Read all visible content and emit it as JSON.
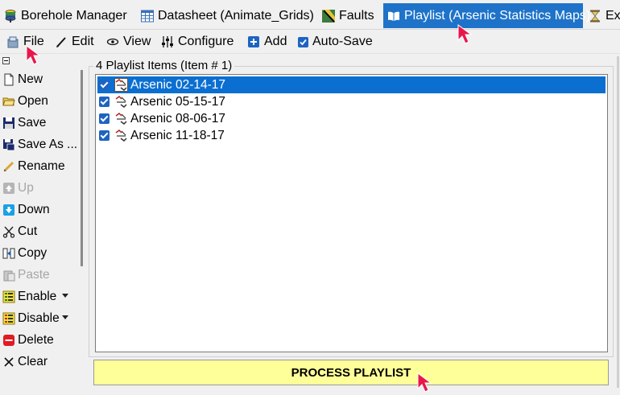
{
  "tabs": [
    {
      "label": "Borehole Manager",
      "icon": "borehole-icon"
    },
    {
      "label": "Datasheet (Animate_Grids)",
      "icon": "datasheet-icon"
    },
    {
      "label": "Faults",
      "icon": "faults-icon"
    },
    {
      "label": "Playlist (Arsenic Statistics Maps)",
      "icon": "book-icon",
      "active": true
    },
    {
      "label": "Exe",
      "icon": "hourglass-icon"
    }
  ],
  "toolbar": {
    "file": "File",
    "edit": "Edit",
    "view": "View",
    "configure": "Configure",
    "add": "Add",
    "autosave": "Auto-Save"
  },
  "sidebar": {
    "items": [
      {
        "label": "New",
        "icon": "new-file-icon",
        "enabled": true
      },
      {
        "label": "Open",
        "icon": "folder-icon",
        "enabled": true
      },
      {
        "label": "Save",
        "icon": "save-icon",
        "enabled": true
      },
      {
        "label": "Save As ...",
        "icon": "save-as-icon",
        "enabled": true
      },
      {
        "label": "Rename",
        "icon": "pencil-icon",
        "enabled": true
      },
      {
        "label": "Up",
        "icon": "arrow-up-icon",
        "enabled": false
      },
      {
        "label": "Down",
        "icon": "arrow-down-icon",
        "enabled": true
      },
      {
        "label": "Cut",
        "icon": "scissors-icon",
        "enabled": true
      },
      {
        "label": "Copy",
        "icon": "copy-icon",
        "enabled": true
      },
      {
        "label": "Paste",
        "icon": "paste-icon",
        "enabled": false
      },
      {
        "label": "Enable",
        "icon": "list-check-icon",
        "enabled": true
      },
      {
        "label": "Disable",
        "icon": "list-uncheck-icon",
        "enabled": true
      },
      {
        "label": "Delete",
        "icon": "delete-icon",
        "enabled": true
      },
      {
        "label": "Clear",
        "icon": "clear-x-icon",
        "enabled": true
      }
    ]
  },
  "playlist": {
    "header": "4 Playlist Items (Item # 1)",
    "items": [
      {
        "label": "Arsenic 02-14-17",
        "checked": true,
        "selected": true
      },
      {
        "label": "Arsenic 05-15-17",
        "checked": true,
        "selected": false
      },
      {
        "label": "Arsenic 08-06-17",
        "checked": true,
        "selected": false
      },
      {
        "label": "Arsenic 11-18-17",
        "checked": true,
        "selected": false
      }
    ]
  },
  "process_button": "PROCESS PLAYLIST",
  "colors": {
    "active_tab": "#1e73c9",
    "selection": "#0b6fd1",
    "process_bg": "#ffff99",
    "pointer": "#e8174a"
  }
}
